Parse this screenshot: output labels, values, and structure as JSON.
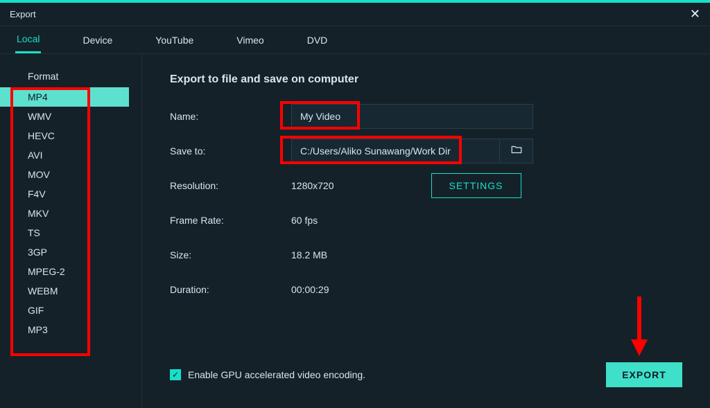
{
  "window": {
    "title": "Export"
  },
  "tabs": [
    {
      "label": "Local",
      "active": true
    },
    {
      "label": "Device",
      "active": false
    },
    {
      "label": "YouTube",
      "active": false
    },
    {
      "label": "Vimeo",
      "active": false
    },
    {
      "label": "DVD",
      "active": false
    }
  ],
  "sidebar": {
    "title": "Format",
    "items": [
      {
        "label": "MP4",
        "selected": true
      },
      {
        "label": "WMV",
        "selected": false
      },
      {
        "label": "HEVC",
        "selected": false
      },
      {
        "label": "AVI",
        "selected": false
      },
      {
        "label": "MOV",
        "selected": false
      },
      {
        "label": "F4V",
        "selected": false
      },
      {
        "label": "MKV",
        "selected": false
      },
      {
        "label": "TS",
        "selected": false
      },
      {
        "label": "3GP",
        "selected": false
      },
      {
        "label": "MPEG-2",
        "selected": false
      },
      {
        "label": "WEBM",
        "selected": false
      },
      {
        "label": "GIF",
        "selected": false
      },
      {
        "label": "MP3",
        "selected": false
      }
    ]
  },
  "main": {
    "heading": "Export to file and save on computer",
    "name_label": "Name:",
    "name_value": "My Video",
    "save_label": "Save to:",
    "save_value": "C:/Users/Aliko Sunawang/Work Dir",
    "resolution_label": "Resolution:",
    "resolution_value": "1280x720",
    "settings_label": "SETTINGS",
    "framerate_label": "Frame Rate:",
    "framerate_value": "60 fps",
    "size_label": "Size:",
    "size_value": "18.2 MB",
    "duration_label": "Duration:",
    "duration_value": "00:00:29",
    "gpu_label": "Enable GPU accelerated video encoding.",
    "gpu_checked": true,
    "export_label": "EXPORT"
  },
  "colors": {
    "accent": "#16e0c9",
    "bg": "#152129",
    "panel": "#182832",
    "text": "#d7e6ef",
    "highlight_fill": "#5ee0cf",
    "export_fill": "#3fe0c9",
    "annotation": "#ff0000"
  }
}
